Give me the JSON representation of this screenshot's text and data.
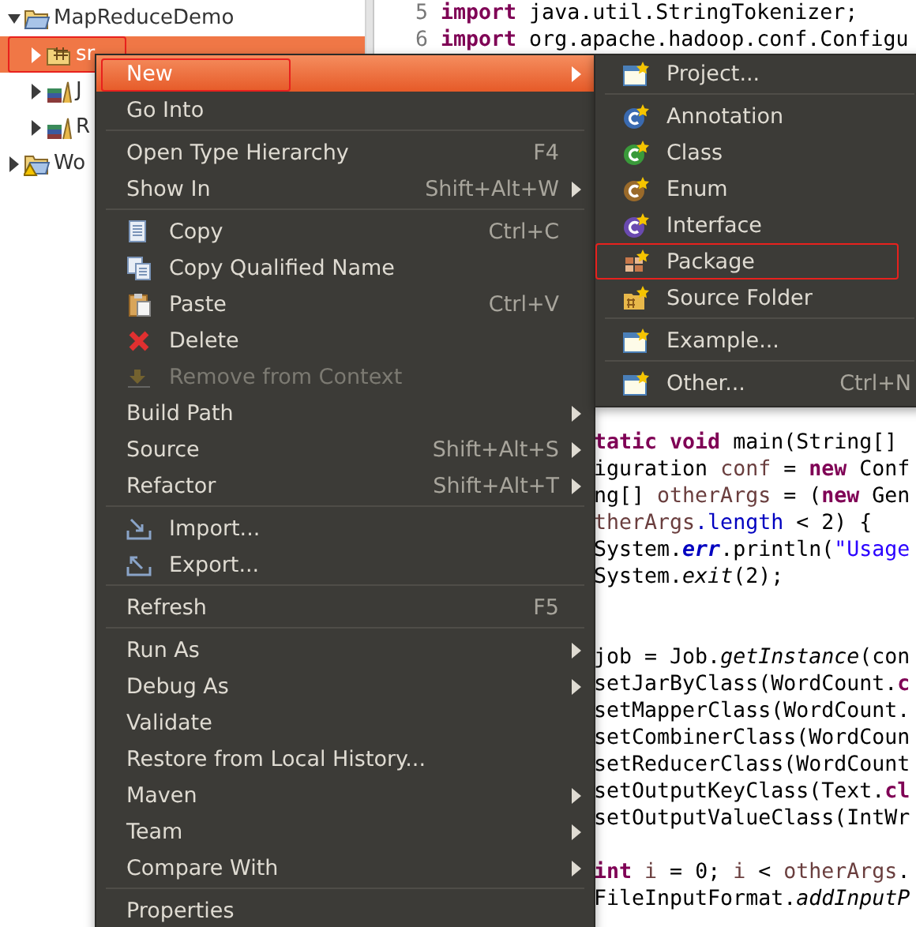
{
  "tree": {
    "items": [
      {
        "label": "MapReduceDemo",
        "kind": "project",
        "expanded": true,
        "selected": false,
        "marked": false,
        "children": [
          {
            "label": "sr",
            "kind": "source-folder",
            "expanded": false,
            "selected": true,
            "marked": true
          },
          {
            "label": "J",
            "kind": "library",
            "expanded": false,
            "selected": false,
            "marked": false
          },
          {
            "label": "R",
            "kind": "library",
            "expanded": false,
            "selected": false,
            "marked": false
          }
        ]
      },
      {
        "label": "Wo",
        "kind": "project-warning",
        "expanded": false,
        "selected": false,
        "marked": false
      }
    ]
  },
  "editor": {
    "top_lines": [
      {
        "number": "5",
        "kind": "code",
        "tokens": [
          {
            "kind": "keyword",
            "text": "import"
          },
          {
            "kind": "plain",
            "text": " java.util.StringTokenizer;"
          }
        ]
      },
      {
        "number": "6",
        "kind": "code",
        "tokens": [
          {
            "kind": "keyword",
            "text": "import"
          },
          {
            "kind": "plain",
            "text": " org.apache.hadoop.conf.Configu"
          }
        ]
      }
    ],
    "lower_lines": [
      {
        "kind": "code",
        "tokens": [
          {
            "kind": "keyword",
            "text": "tatic void"
          },
          {
            "kind": "plain",
            "text": " main(String[]"
          }
        ]
      },
      {
        "kind": "code",
        "tokens": [
          {
            "kind": "plain",
            "text": "iguration "
          },
          {
            "kind": "variable",
            "text": "conf"
          },
          {
            "kind": "plain",
            "text": " = "
          },
          {
            "kind": "keyword",
            "text": "new"
          },
          {
            "kind": "plain",
            "text": " Conf"
          }
        ]
      },
      {
        "kind": "code",
        "tokens": [
          {
            "kind": "plain",
            "text": "ng[] "
          },
          {
            "kind": "variable",
            "text": "otherArgs"
          },
          {
            "kind": "plain",
            "text": " = ("
          },
          {
            "kind": "keyword",
            "text": "new"
          },
          {
            "kind": "plain",
            "text": " Gen"
          }
        ]
      },
      {
        "kind": "code",
        "tokens": [
          {
            "kind": "variable",
            "text": "therArgs"
          },
          {
            "kind": "field",
            "text": ".length"
          },
          {
            "kind": "plain",
            "text": " < 2) {"
          }
        ]
      },
      {
        "kind": "code",
        "tokens": [
          {
            "kind": "plain",
            "text": "System."
          },
          {
            "kind": "static-field",
            "text": "err"
          },
          {
            "kind": "plain",
            "text": ".println("
          },
          {
            "kind": "string",
            "text": "\"Usage"
          }
        ]
      },
      {
        "kind": "code",
        "tokens": [
          {
            "kind": "plain",
            "text": "System."
          },
          {
            "kind": "static",
            "text": "exit"
          },
          {
            "kind": "plain",
            "text": "(2);"
          }
        ]
      },
      {
        "kind": "blank"
      },
      {
        "kind": "blank"
      },
      {
        "kind": "code",
        "tokens": [
          {
            "kind": "plain",
            "text": "job = Job."
          },
          {
            "kind": "static",
            "text": "getInstance"
          },
          {
            "kind": "plain",
            "text": "(con"
          }
        ]
      },
      {
        "kind": "code",
        "tokens": [
          {
            "kind": "plain",
            "text": "setJarByClass(WordCount."
          },
          {
            "kind": "keyword",
            "text": "c"
          }
        ]
      },
      {
        "kind": "code",
        "tokens": [
          {
            "kind": "plain",
            "text": "setMapperClass(WordCount."
          }
        ]
      },
      {
        "kind": "code",
        "tokens": [
          {
            "kind": "plain",
            "text": "setCombinerClass(WordCoun"
          }
        ]
      },
      {
        "kind": "code",
        "tokens": [
          {
            "kind": "plain",
            "text": "setReducerClass(WordCount"
          }
        ]
      },
      {
        "kind": "code",
        "tokens": [
          {
            "kind": "plain",
            "text": "setOutputKeyClass(Text."
          },
          {
            "kind": "keyword",
            "text": "cl"
          }
        ]
      },
      {
        "kind": "code",
        "tokens": [
          {
            "kind": "plain",
            "text": "setOutputValueClass(IntWr"
          }
        ]
      },
      {
        "kind": "blank"
      },
      {
        "kind": "code",
        "tokens": [
          {
            "kind": "keyword",
            "text": "int"
          },
          {
            "kind": "variable",
            "text": " i"
          },
          {
            "kind": "plain",
            "text": " = 0; "
          },
          {
            "kind": "variable",
            "text": "i"
          },
          {
            "kind": "plain",
            "text": " < "
          },
          {
            "kind": "variable",
            "text": "otherArgs"
          },
          {
            "kind": "plain",
            "text": "."
          }
        ]
      },
      {
        "kind": "code",
        "tokens": [
          {
            "kind": "plain",
            "text": "FileInputFormat."
          },
          {
            "kind": "static",
            "text": "addInputP"
          }
        ]
      }
    ]
  },
  "context_menu": {
    "items": [
      {
        "kind": "plain",
        "label": "New",
        "submenu": true,
        "disabled": false,
        "highlighted": true,
        "marked": true
      },
      {
        "kind": "plain",
        "label": "Go Into",
        "submenu": false,
        "disabled": false,
        "highlighted": false,
        "marked": false
      },
      {
        "kind": "separator"
      },
      {
        "kind": "plain",
        "label": "Open Type Hierarchy",
        "shortcut": "F4",
        "submenu": false,
        "disabled": false,
        "highlighted": false,
        "marked": false
      },
      {
        "kind": "plain",
        "label": "Show In",
        "shortcut": "Shift+Alt+W",
        "submenu": true,
        "disabled": false,
        "highlighted": false,
        "marked": false
      },
      {
        "kind": "separator"
      },
      {
        "kind": "copy",
        "label": "Copy",
        "shortcut": "Ctrl+C",
        "submenu": false,
        "disabled": false,
        "highlighted": false,
        "marked": false
      },
      {
        "kind": "copy-name",
        "label": "Copy Qualified Name",
        "submenu": false,
        "disabled": false,
        "highlighted": false,
        "marked": false
      },
      {
        "kind": "paste",
        "label": "Paste",
        "shortcut": "Ctrl+V",
        "submenu": false,
        "disabled": false,
        "highlighted": false,
        "marked": false
      },
      {
        "kind": "delete",
        "label": "Delete",
        "submenu": false,
        "disabled": false,
        "highlighted": false,
        "marked": false
      },
      {
        "kind": "remove",
        "label": "Remove from Context",
        "submenu": false,
        "disabled": true,
        "highlighted": false,
        "marked": false
      },
      {
        "kind": "plain",
        "label": "Build Path",
        "submenu": true,
        "disabled": false,
        "highlighted": false,
        "marked": false
      },
      {
        "kind": "plain",
        "label": "Source",
        "shortcut": "Shift+Alt+S",
        "submenu": true,
        "disabled": false,
        "highlighted": false,
        "marked": false
      },
      {
        "kind": "plain",
        "label": "Refactor",
        "shortcut": "Shift+Alt+T",
        "submenu": true,
        "disabled": false,
        "highlighted": false,
        "marked": false
      },
      {
        "kind": "separator"
      },
      {
        "kind": "import",
        "label": "Import...",
        "submenu": false,
        "disabled": false,
        "highlighted": false,
        "marked": false
      },
      {
        "kind": "export",
        "label": "Export...",
        "submenu": false,
        "disabled": false,
        "highlighted": false,
        "marked": false
      },
      {
        "kind": "separator"
      },
      {
        "kind": "plain",
        "label": "Refresh",
        "shortcut": "F5",
        "submenu": false,
        "disabled": false,
        "highlighted": false,
        "marked": false
      },
      {
        "kind": "separator"
      },
      {
        "kind": "plain",
        "label": "Run As",
        "submenu": true,
        "disabled": false,
        "highlighted": false,
        "marked": false
      },
      {
        "kind": "plain",
        "label": "Debug As",
        "submenu": true,
        "disabled": false,
        "highlighted": false,
        "marked": false
      },
      {
        "kind": "plain",
        "label": "Validate",
        "submenu": false,
        "disabled": false,
        "highlighted": false,
        "marked": false
      },
      {
        "kind": "plain",
        "label": "Restore from Local History...",
        "submenu": false,
        "disabled": false,
        "highlighted": false,
        "marked": false
      },
      {
        "kind": "plain",
        "label": "Maven",
        "submenu": true,
        "disabled": false,
        "highlighted": false,
        "marked": false
      },
      {
        "kind": "plain",
        "label": "Team",
        "submenu": true,
        "disabled": false,
        "highlighted": false,
        "marked": false
      },
      {
        "kind": "plain",
        "label": "Compare With",
        "submenu": true,
        "disabled": false,
        "highlighted": false,
        "marked": false
      },
      {
        "kind": "separator"
      },
      {
        "kind": "plain",
        "label": "Properties",
        "submenu": false,
        "disabled": false,
        "highlighted": false,
        "marked": false
      }
    ]
  },
  "submenu": {
    "items": [
      {
        "kind": "project",
        "label": "Project...",
        "submenu": false,
        "disabled": false,
        "highlighted": false,
        "marked": false
      },
      {
        "kind": "separator"
      },
      {
        "kind": "annotation",
        "label": "Annotation",
        "submenu": false,
        "disabled": false,
        "highlighted": false,
        "marked": false
      },
      {
        "kind": "class",
        "label": "Class",
        "submenu": false,
        "disabled": false,
        "highlighted": false,
        "marked": false
      },
      {
        "kind": "enum",
        "label": "Enum",
        "submenu": false,
        "disabled": false,
        "highlighted": false,
        "marked": false
      },
      {
        "kind": "interface",
        "label": "Interface",
        "submenu": false,
        "disabled": false,
        "highlighted": false,
        "marked": false
      },
      {
        "kind": "package",
        "label": "Package",
        "submenu": false,
        "disabled": false,
        "highlighted": false,
        "marked": true
      },
      {
        "kind": "source-folder",
        "label": "Source Folder",
        "submenu": false,
        "disabled": false,
        "highlighted": false,
        "marked": false
      },
      {
        "kind": "separator"
      },
      {
        "kind": "example",
        "label": "Example...",
        "submenu": false,
        "disabled": false,
        "highlighted": false,
        "marked": false
      },
      {
        "kind": "separator"
      },
      {
        "kind": "other",
        "label": "Other...",
        "shortcut": "Ctrl+N",
        "submenu": false,
        "disabled": false,
        "highlighted": false,
        "marked": false
      }
    ]
  }
}
